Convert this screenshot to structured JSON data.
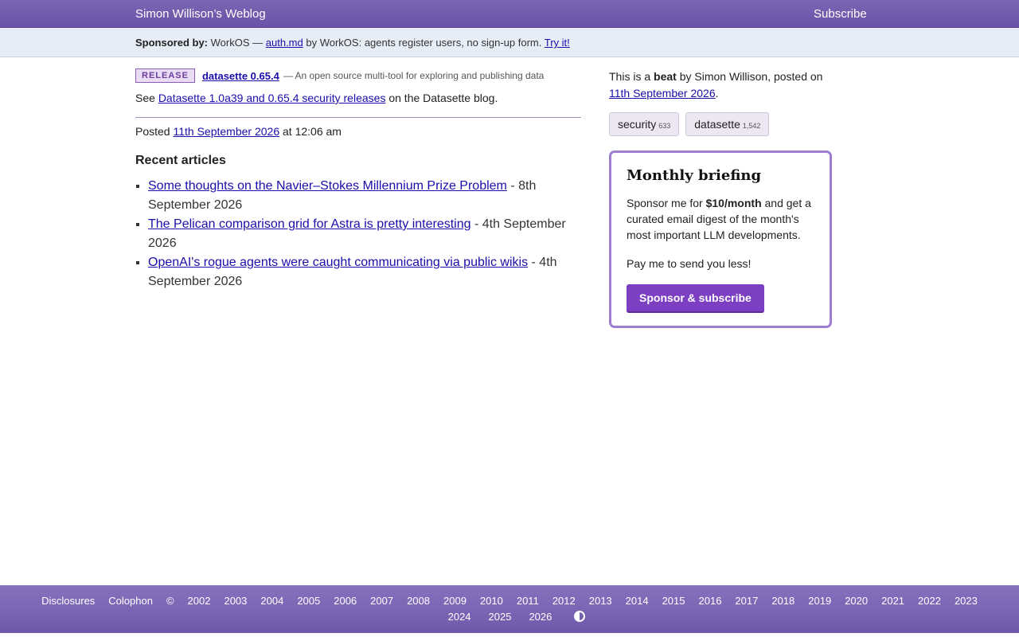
{
  "header": {
    "site_title": "Simon Willison’s Weblog",
    "subscribe": "Subscribe"
  },
  "sponsor": {
    "label": "Sponsored by:",
    "text_before": "WorkOS —",
    "link": "auth.md",
    "text_after": "by WorkOS: agents register users, no sign-up form.",
    "cta": "Try it!"
  },
  "release": {
    "badge": "RELEASE",
    "title": "datasette 0.65.4",
    "description": "— An open source multi-tool for exploring and publishing data",
    "see_prefix": "See",
    "see_link": "Datasette 1.0a39 and 0.65.4 security releases",
    "see_suffix": "on the Datasette blog."
  },
  "posted": {
    "prefix": "Posted",
    "date": "11th September 2026",
    "time": "at 12:06 am"
  },
  "recent": {
    "title": "Recent articles",
    "items": [
      {
        "title": "Some thoughts on the Navier–Stokes Millennium Prize Problem",
        "date": "- 8th September 2026"
      },
      {
        "title": "The Pelican comparison grid for Astra is pretty interesting",
        "date": "- 4th September 2026"
      },
      {
        "title": "OpenAI's rogue agents were caught communicating via public wikis",
        "date": "- 4th September 2026"
      }
    ]
  },
  "sidebar": {
    "beat_prefix": "This is a",
    "beat_word": "beat",
    "beat_suffix": "by Simon Willison, posted on",
    "beat_date": "11th September 2026",
    "beat_end": ".",
    "tags": [
      {
        "label": "security",
        "count": "633"
      },
      {
        "label": "datasette",
        "count": "1,542"
      }
    ],
    "briefing": {
      "title": "Monthly briefing",
      "text_prefix": "Sponsor me for",
      "price": "$10/month",
      "text_suffix": "and get a curated email digest of the month's most important LLM developments.",
      "pay": "Pay me to send you less!",
      "button": "Sponsor & subscribe"
    }
  },
  "footer": {
    "links": [
      "Disclosures",
      "Colophon",
      "©",
      "2002",
      "2003",
      "2004",
      "2005",
      "2006",
      "2007",
      "2008",
      "2009",
      "2010",
      "2011",
      "2012",
      "2013",
      "2014",
      "2015",
      "2016",
      "2017",
      "2018",
      "2019",
      "2020",
      "2021",
      "2022",
      "2023"
    ],
    "links_row2": [
      "2024",
      "2025",
      "2026"
    ]
  }
}
